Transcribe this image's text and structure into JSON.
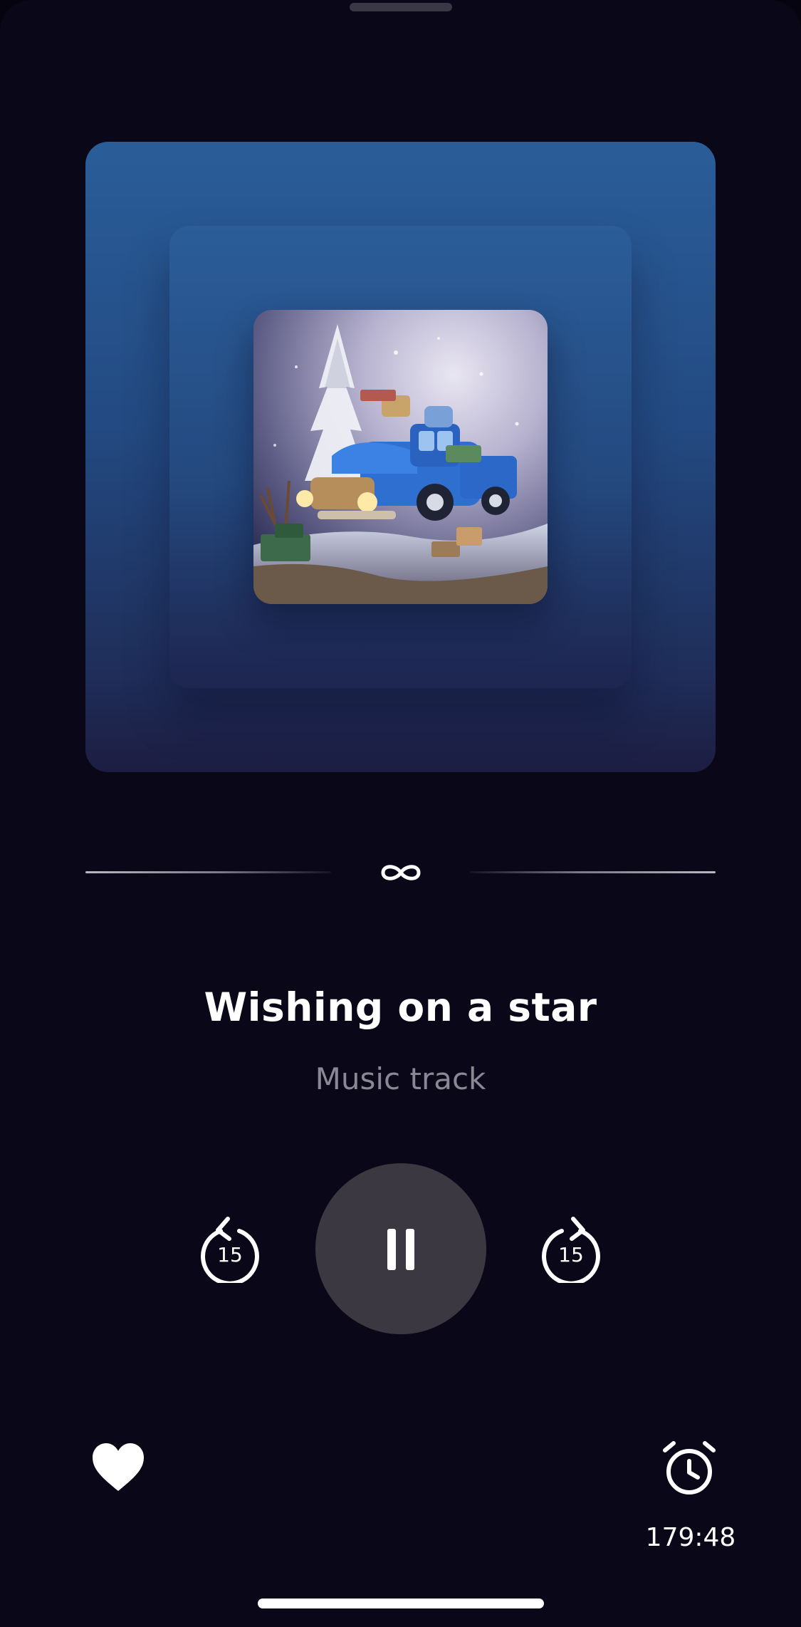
{
  "player": {
    "title": "Wishing on a star",
    "subtitle": "Music track",
    "loop_symbol": "∞",
    "skip_back_seconds": "15",
    "skip_forward_seconds": "15",
    "sleep_timer": "179:48",
    "state": "playing"
  },
  "icons": {
    "rewind": "rewind-15-icon",
    "forward": "forward-15-icon",
    "pause": "pause-icon",
    "favorite": "heart-icon",
    "timer": "alarm-clock-icon",
    "loop": "infinity-icon"
  },
  "colors": {
    "background": "#0a0818",
    "art_top": "#2a5d98",
    "art_bottom": "#1d1d42",
    "play_button": "#3b3841",
    "subtitle": "#8b8896"
  }
}
